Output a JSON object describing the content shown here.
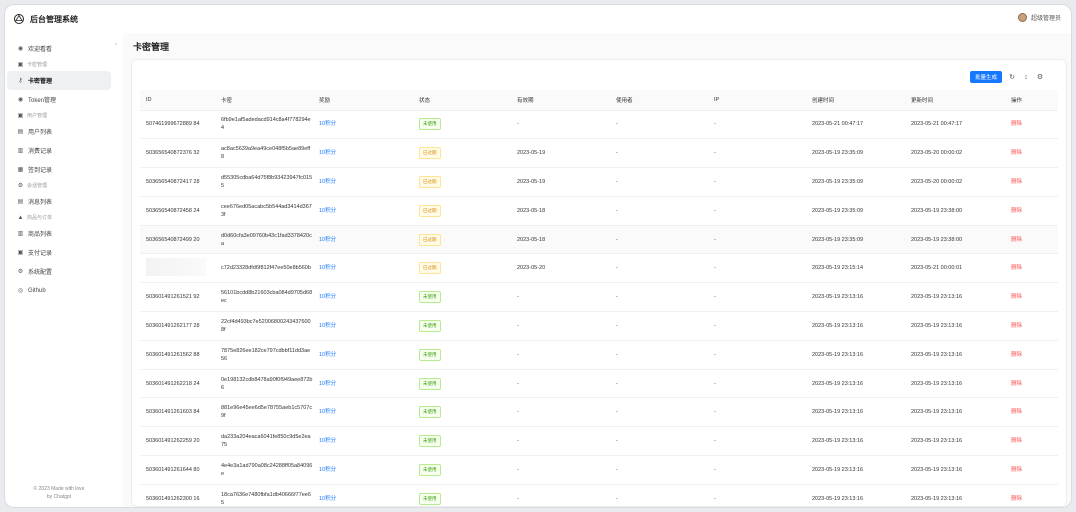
{
  "app": {
    "title": "后台管理系统",
    "user": "超级管理员"
  },
  "sidebar": {
    "items": [
      {
        "type": "item",
        "label": "欢迎看看",
        "icon": "dashboard-icon",
        "glyph": "◉"
      },
      {
        "type": "group",
        "label": "卡密管理",
        "icon": "group-icon",
        "glyph": "▣"
      },
      {
        "type": "item",
        "label": "卡密管理",
        "icon": "key-icon",
        "glyph": "⚷",
        "active": true
      },
      {
        "type": "item",
        "label": "Token管理",
        "icon": "token-icon",
        "glyph": "◉"
      },
      {
        "type": "group",
        "label": "用户管理",
        "icon": "group-icon",
        "glyph": "▣"
      },
      {
        "type": "item",
        "label": "用户列表",
        "icon": "user-list-icon",
        "glyph": "▤"
      },
      {
        "type": "item",
        "label": "消费记录",
        "icon": "record-icon",
        "glyph": "▥"
      },
      {
        "type": "item",
        "label": "签到记录",
        "icon": "checkin-icon",
        "glyph": "▦"
      },
      {
        "type": "group",
        "label": "会话管理",
        "icon": "group-icon",
        "glyph": "⚙"
      },
      {
        "type": "item",
        "label": "消息列表",
        "icon": "message-icon",
        "glyph": "▤"
      },
      {
        "type": "group",
        "label": "商品与订单",
        "icon": "group-icon",
        "glyph": "▲"
      },
      {
        "type": "item",
        "label": "商品列表",
        "icon": "goods-icon",
        "glyph": "▥"
      },
      {
        "type": "item",
        "label": "支付记录",
        "icon": "payment-icon",
        "glyph": "▣"
      },
      {
        "type": "item",
        "label": "系统配置",
        "icon": "settings-icon",
        "glyph": "⚙"
      },
      {
        "type": "item",
        "label": "Github",
        "icon": "github-icon",
        "glyph": "◎"
      }
    ],
    "footer_line1": "© 2023 Made with love",
    "footer_line2": "by Chatgpt"
  },
  "page": {
    "title": "卡密管理"
  },
  "toolbar": {
    "generate_label": "批量生成"
  },
  "table": {
    "columns": [
      "ID",
      "卡密",
      "奖励",
      "状态",
      "有效期",
      "使用者",
      "IP",
      "创建时间",
      "更新时间",
      "操作"
    ],
    "rows": [
      {
        "id": "507461999672889 84",
        "code": "6fb9e1af5adedacd914c8a4f778294e4",
        "reward": "10积分",
        "status": "未使用",
        "status_type": "unused",
        "expire": "-",
        "user": "-",
        "ip": "-",
        "created": "2023-05-21 00:47:17",
        "updated": "2023-05-21 00:47:17",
        "action": "删除"
      },
      {
        "id": "503656540872376 32",
        "code": "ac8ac5639a9ea49ce048f5b5ae89eff8",
        "reward": "10积分",
        "status": "已过期",
        "status_type": "expired",
        "expire": "2023-05-19",
        "user": "-",
        "ip": "-",
        "created": "2023-05-19 23:35:09",
        "updated": "2023-05-20 00:00:02",
        "action": "删除"
      },
      {
        "id": "503656540872417 28",
        "code": "d55305cdba64d75f8b93423947fc0155",
        "reward": "10积分",
        "status": "已过期",
        "status_type": "expired",
        "expire": "2023-05-19",
        "user": "-",
        "ip": "-",
        "created": "2023-05-19 23:35:09",
        "updated": "2023-05-20 00:00:02",
        "action": "删除"
      },
      {
        "id": "503656540872458 24",
        "code": "cee676ed05acabc5b544ad3414d3673f",
        "reward": "10积分",
        "status": "已过期",
        "status_type": "expired",
        "expire": "2023-05-18",
        "user": "-",
        "ip": "-",
        "created": "2023-05-19 23:35:09",
        "updated": "2023-05-19 23:38:00",
        "action": "删除"
      },
      {
        "id": "503656540872499 20",
        "code": "d0d60cfa3e09760b43c1fad3378420ca",
        "reward": "10积分",
        "status": "已过期",
        "status_type": "expired",
        "expire": "2023-05-18",
        "user": "-",
        "ip": "-",
        "created": "2023-05-19 23:35:09",
        "updated": "2023-05-19 23:38:00",
        "action": "删除",
        "highlight": true
      },
      {
        "id": "",
        "code": "c72d23328dfd6f812f47ee50e8b560b",
        "reward": "10积分",
        "status": "已过期",
        "status_type": "expired",
        "expire": "2023-05-20",
        "user": "-",
        "ip": "-",
        "created": "2023-05-19 23:15:14",
        "updated": "2023-05-21 00:00:01",
        "action": "删除",
        "blur": true
      },
      {
        "id": "503601491261521 92",
        "code": "56101bcdd8b21603cba084d9705d68ec",
        "reward": "10积分",
        "status": "未使用",
        "status_type": "unused",
        "expire": "-",
        "user": "-",
        "ip": "-",
        "created": "2023-05-19 23:13:16",
        "updated": "2023-05-19 23:13:16",
        "action": "删除"
      },
      {
        "id": "503601491262177 28",
        "code": "22cf4d493bc7e520068002434376008f",
        "reward": "10积分",
        "status": "未使用",
        "status_type": "unused",
        "expire": "-",
        "user": "-",
        "ip": "-",
        "created": "2023-05-19 23:13:16",
        "updated": "2023-05-19 23:13:16",
        "action": "删除"
      },
      {
        "id": "503601491261562 88",
        "code": "7875e826ee182ce797cdbbf11dd3ae56",
        "reward": "10积分",
        "status": "未使用",
        "status_type": "unused",
        "expire": "-",
        "user": "-",
        "ip": "-",
        "created": "2023-05-19 23:13:16",
        "updated": "2023-05-19 23:13:16",
        "action": "删除"
      },
      {
        "id": "503601491262218 24",
        "code": "0e198132cdb8478a90f0f949aee872b6",
        "reward": "10积分",
        "status": "未使用",
        "status_type": "unused",
        "expire": "-",
        "user": "-",
        "ip": "-",
        "created": "2023-05-19 23:13:16",
        "updated": "2023-05-19 23:13:16",
        "action": "删除"
      },
      {
        "id": "503601491261603 84",
        "code": "881e96e45ee6d5e78755aeb1c5707c9f",
        "reward": "10积分",
        "status": "未使用",
        "status_type": "unused",
        "expire": "-",
        "user": "-",
        "ip": "-",
        "created": "2023-05-19 23:13:16",
        "updated": "2023-05-19 23:13:16",
        "action": "删除"
      },
      {
        "id": "503601491262259 20",
        "code": "da233a204eaca6041fe850c9d5e2ea75",
        "reward": "10积分",
        "status": "未使用",
        "status_type": "unused",
        "expire": "-",
        "user": "-",
        "ip": "-",
        "created": "2023-05-19 23:13:16",
        "updated": "2023-05-19 23:13:16",
        "action": "删除"
      },
      {
        "id": "503601491261644 80",
        "code": "4e4e3a1ad790a08c24288ff05a84096e",
        "reward": "10积分",
        "status": "未使用",
        "status_type": "unused",
        "expire": "-",
        "user": "-",
        "ip": "-",
        "created": "2023-05-19 23:13:16",
        "updated": "2023-05-19 23:13:16",
        "action": "删除"
      },
      {
        "id": "503601491262300 16",
        "code": "18ca7636e7480fbfa1db40666f77ee65",
        "reward": "10积分",
        "status": "未使用",
        "status_type": "unused",
        "expire": "-",
        "user": "-",
        "ip": "-",
        "created": "2023-05-19 23:13:16",
        "updated": "2023-05-19 23:13:16",
        "action": "删除"
      }
    ]
  }
}
